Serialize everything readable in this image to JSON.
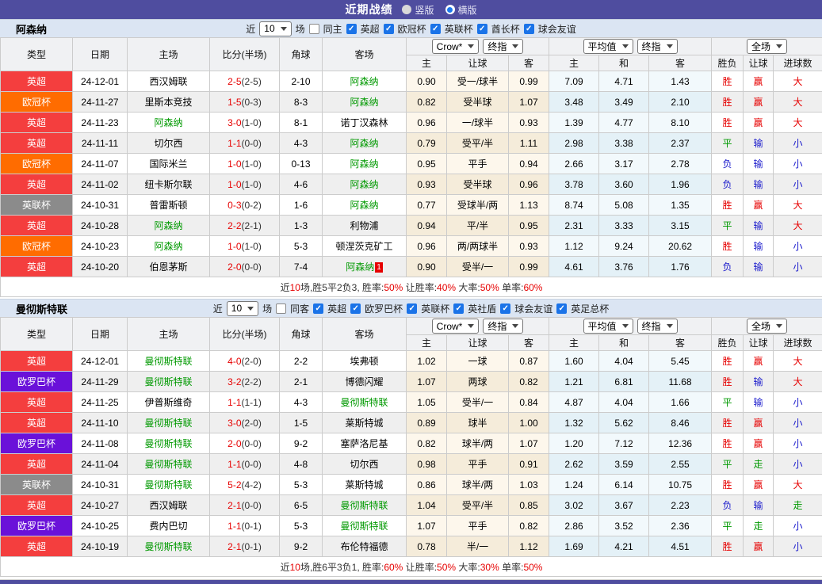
{
  "header": {
    "title": "近期战绩",
    "view_options": [
      {
        "label": "竖版",
        "selected": false
      },
      {
        "label": "横版",
        "selected": true
      }
    ]
  },
  "league_colors": {
    "英超": "#f43e3e",
    "欧冠杯": "#ff6c00",
    "英联杯": "#8b8b8b",
    "欧罗巴杯": "#6a11d9"
  },
  "table_headers": {
    "base": [
      "类型",
      "日期",
      "主场",
      "比分(半场)",
      "角球",
      "客场"
    ],
    "odds_sub": [
      "主",
      "让球",
      "客"
    ],
    "avg_sub": [
      "主",
      "和",
      "客"
    ],
    "result_sub": [
      "胜负",
      "让球",
      "进球数"
    ]
  },
  "sections": [
    {
      "team": "阿森纳",
      "filter": {
        "prefix": "近",
        "matches": "10",
        "suffix": "场",
        "same_label": "同主",
        "same_checked": false,
        "leagues": [
          "英超",
          "欧冠杯",
          "英联杯",
          "酋长杯",
          "球会友谊"
        ]
      },
      "selects": {
        "odds_source": "Crow*",
        "odds_index": "终指",
        "avg_source": "平均值",
        "avg_index": "终指",
        "scope": "全场"
      },
      "rows": [
        {
          "league": "英超",
          "date": "24-12-01",
          "home": "西汉姆联",
          "home_focus": false,
          "score": "2-5",
          "half": "(2-5)",
          "corner": "2-10",
          "away": "阿森纳",
          "away_focus": true,
          "away_badge": "",
          "h_odds": "0.90",
          "handicap": "受一/球半",
          "a_odds": "0.99",
          "avg_h": "7.09",
          "avg_d": "4.71",
          "avg_a": "1.43",
          "result": "胜",
          "result_c": "r",
          "let_result": "赢",
          "let_c": "r",
          "goal_result": "大",
          "goal_c": "r"
        },
        {
          "league": "欧冠杯",
          "date": "24-11-27",
          "home": "里斯本竞技",
          "home_focus": false,
          "score": "1-5",
          "half": "(0-3)",
          "corner": "8-3",
          "away": "阿森纳",
          "away_focus": true,
          "away_badge": "",
          "h_odds": "0.82",
          "handicap": "受半球",
          "a_odds": "1.07",
          "avg_h": "3.48",
          "avg_d": "3.49",
          "avg_a": "2.10",
          "result": "胜",
          "result_c": "r",
          "let_result": "赢",
          "let_c": "r",
          "goal_result": "大",
          "goal_c": "r"
        },
        {
          "league": "英超",
          "date": "24-11-23",
          "home": "阿森纳",
          "home_focus": true,
          "score": "3-0",
          "half": "(1-0)",
          "corner": "8-1",
          "away": "诺丁汉森林",
          "away_focus": false,
          "away_badge": "",
          "h_odds": "0.96",
          "handicap": "一/球半",
          "a_odds": "0.93",
          "avg_h": "1.39",
          "avg_d": "4.77",
          "avg_a": "8.10",
          "result": "胜",
          "result_c": "r",
          "let_result": "赢",
          "let_c": "r",
          "goal_result": "大",
          "goal_c": "r"
        },
        {
          "league": "英超",
          "date": "24-11-11",
          "home": "切尔西",
          "home_focus": false,
          "score": "1-1",
          "half": "(0-0)",
          "corner": "4-3",
          "away": "阿森纳",
          "away_focus": true,
          "away_badge": "",
          "h_odds": "0.79",
          "handicap": "受平/半",
          "a_odds": "1.11",
          "avg_h": "2.98",
          "avg_d": "3.38",
          "avg_a": "2.37",
          "result": "平",
          "result_c": "g",
          "let_result": "输",
          "let_c": "b",
          "goal_result": "小",
          "goal_c": "b"
        },
        {
          "league": "欧冠杯",
          "date": "24-11-07",
          "home": "国际米兰",
          "home_focus": false,
          "score": "1-0",
          "half": "(1-0)",
          "corner": "0-13",
          "away": "阿森纳",
          "away_focus": true,
          "away_badge": "",
          "h_odds": "0.95",
          "handicap": "平手",
          "a_odds": "0.94",
          "avg_h": "2.66",
          "avg_d": "3.17",
          "avg_a": "2.78",
          "result": "负",
          "result_c": "b",
          "let_result": "输",
          "let_c": "b",
          "goal_result": "小",
          "goal_c": "b"
        },
        {
          "league": "英超",
          "date": "24-11-02",
          "home": "纽卡斯尔联",
          "home_focus": false,
          "score": "1-0",
          "half": "(1-0)",
          "corner": "4-6",
          "away": "阿森纳",
          "away_focus": true,
          "away_badge": "",
          "h_odds": "0.93",
          "handicap": "受半球",
          "a_odds": "0.96",
          "avg_h": "3.78",
          "avg_d": "3.60",
          "avg_a": "1.96",
          "result": "负",
          "result_c": "b",
          "let_result": "输",
          "let_c": "b",
          "goal_result": "小",
          "goal_c": "b"
        },
        {
          "league": "英联杯",
          "date": "24-10-31",
          "home": "普雷斯顿",
          "home_focus": false,
          "score": "0-3",
          "half": "(0-2)",
          "corner": "1-6",
          "away": "阿森纳",
          "away_focus": true,
          "away_badge": "",
          "h_odds": "0.77",
          "handicap": "受球半/两",
          "a_odds": "1.13",
          "avg_h": "8.74",
          "avg_d": "5.08",
          "avg_a": "1.35",
          "result": "胜",
          "result_c": "r",
          "let_result": "赢",
          "let_c": "r",
          "goal_result": "大",
          "goal_c": "r"
        },
        {
          "league": "英超",
          "date": "24-10-28",
          "home": "阿森纳",
          "home_focus": true,
          "score": "2-2",
          "half": "(2-1)",
          "corner": "1-3",
          "away": "利物浦",
          "away_focus": false,
          "away_badge": "",
          "h_odds": "0.94",
          "handicap": "平/半",
          "a_odds": "0.95",
          "avg_h": "2.31",
          "avg_d": "3.33",
          "avg_a": "3.15",
          "result": "平",
          "result_c": "g",
          "let_result": "输",
          "let_c": "b",
          "goal_result": "大",
          "goal_c": "r"
        },
        {
          "league": "欧冠杯",
          "date": "24-10-23",
          "home": "阿森纳",
          "home_focus": true,
          "score": "1-0",
          "half": "(1-0)",
          "corner": "5-3",
          "away": "顿涅茨克矿工",
          "away_focus": false,
          "away_badge": "",
          "h_odds": "0.96",
          "handicap": "两/两球半",
          "a_odds": "0.93",
          "avg_h": "1.12",
          "avg_d": "9.24",
          "avg_a": "20.62",
          "result": "胜",
          "result_c": "r",
          "let_result": "输",
          "let_c": "b",
          "goal_result": "小",
          "goal_c": "b"
        },
        {
          "league": "英超",
          "date": "24-10-20",
          "home": "伯恩茅斯",
          "home_focus": false,
          "score": "2-0",
          "half": "(0-0)",
          "corner": "7-4",
          "away": "阿森纳",
          "away_focus": true,
          "away_badge": "1",
          "h_odds": "0.90",
          "handicap": "受半/一",
          "a_odds": "0.99",
          "avg_h": "4.61",
          "avg_d": "3.76",
          "avg_a": "1.76",
          "result": "负",
          "result_c": "b",
          "let_result": "输",
          "let_c": "b",
          "goal_result": "小",
          "goal_c": "b"
        }
      ],
      "summary": [
        "近",
        "10",
        "场,胜5平2负3, 胜率:",
        "50%",
        " 让胜率:",
        "40%",
        " 大率:",
        "50%",
        " 单率:",
        "60%"
      ]
    },
    {
      "team": "曼彻斯特联",
      "filter": {
        "prefix": "近",
        "matches": "10",
        "suffix": "场",
        "same_label": "同客",
        "same_checked": false,
        "leagues": [
          "英超",
          "欧罗巴杯",
          "英联杯",
          "英社盾",
          "球会友谊",
          "英足总杯"
        ]
      },
      "selects": {
        "odds_source": "Crow*",
        "odds_index": "终指",
        "avg_source": "平均值",
        "avg_index": "终指",
        "scope": "全场"
      },
      "rows": [
        {
          "league": "英超",
          "date": "24-12-01",
          "home": "曼彻斯特联",
          "home_focus": true,
          "score": "4-0",
          "half": "(2-0)",
          "corner": "2-2",
          "away": "埃弗顿",
          "away_focus": false,
          "away_badge": "",
          "h_odds": "1.02",
          "handicap": "一球",
          "a_odds": "0.87",
          "avg_h": "1.60",
          "avg_d": "4.04",
          "avg_a": "5.45",
          "result": "胜",
          "result_c": "r",
          "let_result": "赢",
          "let_c": "r",
          "goal_result": "大",
          "goal_c": "r"
        },
        {
          "league": "欧罗巴杯",
          "date": "24-11-29",
          "home": "曼彻斯特联",
          "home_focus": true,
          "score": "3-2",
          "half": "(2-2)",
          "corner": "2-1",
          "away": "博德闪耀",
          "away_focus": false,
          "away_badge": "",
          "h_odds": "1.07",
          "handicap": "两球",
          "a_odds": "0.82",
          "avg_h": "1.21",
          "avg_d": "6.81",
          "avg_a": "11.68",
          "result": "胜",
          "result_c": "r",
          "let_result": "输",
          "let_c": "b",
          "goal_result": "大",
          "goal_c": "r"
        },
        {
          "league": "英超",
          "date": "24-11-25",
          "home": "伊普斯维奇",
          "home_focus": false,
          "score": "1-1",
          "half": "(1-1)",
          "corner": "4-3",
          "away": "曼彻斯特联",
          "away_focus": true,
          "away_badge": "",
          "h_odds": "1.05",
          "handicap": "受半/一",
          "a_odds": "0.84",
          "avg_h": "4.87",
          "avg_d": "4.04",
          "avg_a": "1.66",
          "result": "平",
          "result_c": "g",
          "let_result": "输",
          "let_c": "b",
          "goal_result": "小",
          "goal_c": "b"
        },
        {
          "league": "英超",
          "date": "24-11-10",
          "home": "曼彻斯特联",
          "home_focus": true,
          "score": "3-0",
          "half": "(2-0)",
          "corner": "1-5",
          "away": "莱斯特城",
          "away_focus": false,
          "away_badge": "",
          "h_odds": "0.89",
          "handicap": "球半",
          "a_odds": "1.00",
          "avg_h": "1.32",
          "avg_d": "5.62",
          "avg_a": "8.46",
          "result": "胜",
          "result_c": "r",
          "let_result": "赢",
          "let_c": "r",
          "goal_result": "小",
          "goal_c": "b"
        },
        {
          "league": "欧罗巴杯",
          "date": "24-11-08",
          "home": "曼彻斯特联",
          "home_focus": true,
          "score": "2-0",
          "half": "(0-0)",
          "corner": "9-2",
          "away": "塞萨洛尼基",
          "away_focus": false,
          "away_badge": "",
          "h_odds": "0.82",
          "handicap": "球半/两",
          "a_odds": "1.07",
          "avg_h": "1.20",
          "avg_d": "7.12",
          "avg_a": "12.36",
          "result": "胜",
          "result_c": "r",
          "let_result": "赢",
          "let_c": "r",
          "goal_result": "小",
          "goal_c": "b"
        },
        {
          "league": "英超",
          "date": "24-11-04",
          "home": "曼彻斯特联",
          "home_focus": true,
          "score": "1-1",
          "half": "(0-0)",
          "corner": "4-8",
          "away": "切尔西",
          "away_focus": false,
          "away_badge": "",
          "h_odds": "0.98",
          "handicap": "平手",
          "a_odds": "0.91",
          "avg_h": "2.62",
          "avg_d": "3.59",
          "avg_a": "2.55",
          "result": "平",
          "result_c": "g",
          "let_result": "走",
          "let_c": "g",
          "goal_result": "小",
          "goal_c": "b"
        },
        {
          "league": "英联杯",
          "date": "24-10-31",
          "home": "曼彻斯特联",
          "home_focus": true,
          "score": "5-2",
          "half": "(4-2)",
          "corner": "5-3",
          "away": "莱斯特城",
          "away_focus": false,
          "away_badge": "",
          "h_odds": "0.86",
          "handicap": "球半/两",
          "a_odds": "1.03",
          "avg_h": "1.24",
          "avg_d": "6.14",
          "avg_a": "10.75",
          "result": "胜",
          "result_c": "r",
          "let_result": "赢",
          "let_c": "r",
          "goal_result": "大",
          "goal_c": "r"
        },
        {
          "league": "英超",
          "date": "24-10-27",
          "home": "西汉姆联",
          "home_focus": false,
          "score": "2-1",
          "half": "(0-0)",
          "corner": "6-5",
          "away": "曼彻斯特联",
          "away_focus": true,
          "away_badge": "",
          "h_odds": "1.04",
          "handicap": "受平/半",
          "a_odds": "0.85",
          "avg_h": "3.02",
          "avg_d": "3.67",
          "avg_a": "2.23",
          "result": "负",
          "result_c": "b",
          "let_result": "输",
          "let_c": "b",
          "goal_result": "走",
          "goal_c": "g"
        },
        {
          "league": "欧罗巴杯",
          "date": "24-10-25",
          "home": "费内巴切",
          "home_focus": false,
          "score": "1-1",
          "half": "(0-1)",
          "corner": "5-3",
          "away": "曼彻斯特联",
          "away_focus": true,
          "away_badge": "",
          "h_odds": "1.07",
          "handicap": "平手",
          "a_odds": "0.82",
          "avg_h": "2.86",
          "avg_d": "3.52",
          "avg_a": "2.36",
          "result": "平",
          "result_c": "g",
          "let_result": "走",
          "let_c": "g",
          "goal_result": "小",
          "goal_c": "b"
        },
        {
          "league": "英超",
          "date": "24-10-19",
          "home": "曼彻斯特联",
          "home_focus": true,
          "score": "2-1",
          "half": "(0-1)",
          "corner": "9-2",
          "away": "布伦特福德",
          "away_focus": false,
          "away_badge": "",
          "h_odds": "0.78",
          "handicap": "半/一",
          "a_odds": "1.12",
          "avg_h": "1.69",
          "avg_d": "4.21",
          "avg_a": "4.51",
          "result": "胜",
          "result_c": "r",
          "let_result": "赢",
          "let_c": "r",
          "goal_result": "小",
          "goal_c": "b"
        }
      ],
      "summary": [
        "近",
        "10",
        "场,胜6平3负1, 胜率:",
        "60%",
        " 让胜率:",
        "50%",
        " 大率:",
        "30%",
        " 单率:",
        "50%"
      ]
    }
  ]
}
